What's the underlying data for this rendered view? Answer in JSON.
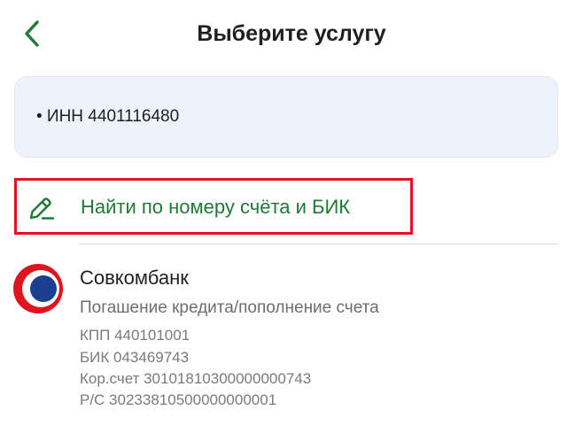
{
  "header": {
    "title": "Выберите услугу",
    "back_icon": "chevron-left-icon"
  },
  "info_card": {
    "inn_text": "• ИНН 4401116480"
  },
  "find_option": {
    "label": "Найти по номеру счёта и БИК",
    "icon": "pencil-icon",
    "color": "#1f7a35",
    "highlight_color": "#e0141e"
  },
  "bank": {
    "name": "Совкомбанк",
    "service": "Погашение кредита/пополнение счета",
    "kpp": "КПП 440101001",
    "bik": "БИК 043469743",
    "kor_schet": "Кор.счет 30101810300000000743",
    "rs": "Р/С 30233810500000000001",
    "logo_colors": [
      "#e0141e",
      "#1a3f8f"
    ]
  },
  "colors": {
    "accent_green": "#1f7a35",
    "card_bg": "#eef2fb"
  }
}
